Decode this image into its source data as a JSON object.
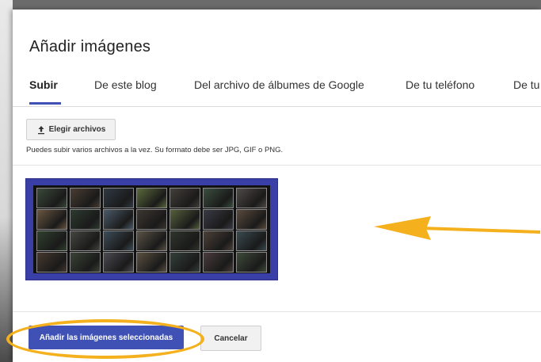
{
  "dialog": {
    "title": "Añadir imágenes",
    "tabs": [
      {
        "label": "Subir",
        "active": true
      },
      {
        "label": "De este blog"
      },
      {
        "label": "Del archivo de álbumes de Google"
      },
      {
        "label": "De tu teléfono"
      },
      {
        "label": "De tu"
      }
    ],
    "choose_files_label": "Elegir archivos",
    "upload_hint": "Puedes subir varios archivos a la vez. Su formato debe ser JPG, GIF o PNG.",
    "add_selected_label": "Añadir las imágenes seleccionadas",
    "cancel_label": "Cancelar"
  },
  "colors": {
    "accent": "#3f51b5",
    "annotation": "#f4b01d",
    "thumbnail_border": "#3a3fa8"
  },
  "icons": {
    "upload": "upload-icon"
  }
}
